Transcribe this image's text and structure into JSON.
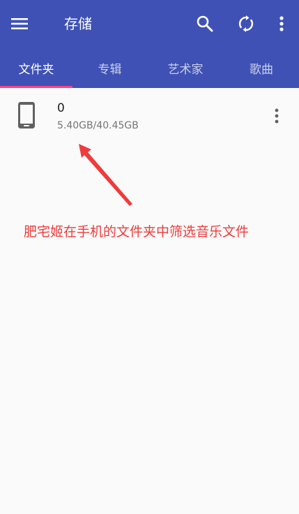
{
  "toolbar": {
    "title": "存储",
    "menu_icon": "menu-icon",
    "search_icon": "search-icon",
    "sync_icon": "sync-icon",
    "more_icon": "more-vert-icon"
  },
  "tabs": [
    {
      "label": "文件夹",
      "active": true
    },
    {
      "label": "专辑",
      "active": false
    },
    {
      "label": "艺术家",
      "active": false
    },
    {
      "label": "歌曲",
      "active": false
    }
  ],
  "storage": {
    "items": [
      {
        "name": "0",
        "usage": "5.40GB/40.45GB",
        "icon": "phone-icon"
      }
    ]
  },
  "annotation": {
    "text": "肥宅姬在手机的文件夹中筛选音乐文件"
  },
  "colors": {
    "primary": "#3f51b5",
    "accent": "#ff4081",
    "annotation": "#ef3b3b",
    "background": "#fafafa"
  }
}
